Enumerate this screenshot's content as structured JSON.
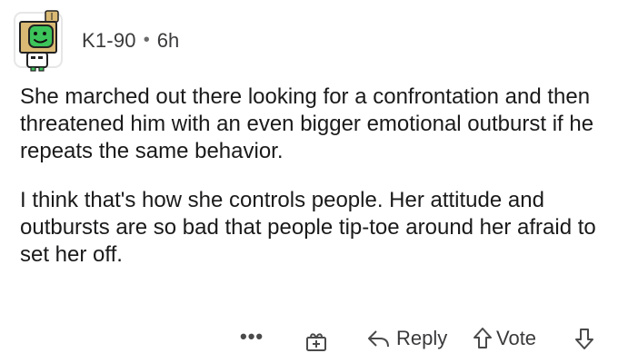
{
  "comment": {
    "username": "K1-90",
    "separator": "•",
    "time": "6h",
    "paragraphs": [
      "She marched out there looking for a confrontation and then threatened him with an even bigger emotional outburst if he repeats the same behavior.",
      "I think that's how she controls people. Her attitude and outbursts are so bad that people tip-toe around her afraid to set her off."
    ]
  },
  "actions": {
    "more_label": "•••",
    "reply_label": "Reply",
    "vote_label": "Vote"
  },
  "icons": {
    "more": "more-options-icon",
    "award": "award-gift-icon",
    "reply": "reply-arrow-icon",
    "upvote": "upvote-arrow-icon",
    "downvote": "downvote-arrow-icon"
  },
  "colors": {
    "text": "#1a1a1b",
    "meta": "#3a3a3c",
    "icon": "#4a4a4a",
    "avatar_green": "#3cc45a",
    "avatar_box": "#d9b974"
  }
}
